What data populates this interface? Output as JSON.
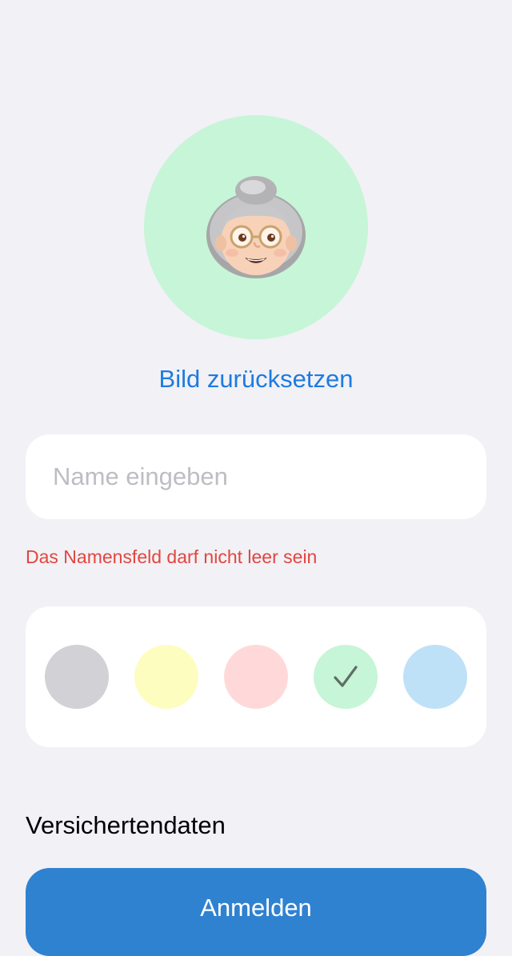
{
  "avatar": {
    "icon": "grandmother-memoji-icon",
    "background_color": "#C7F5D7"
  },
  "reset_link": {
    "label": "Bild zurücksetzen",
    "color": "#1E7BE0"
  },
  "name_field": {
    "value": "",
    "placeholder": "Name eingeben"
  },
  "validation": {
    "error": "Das Namensfeld darf nicht leer sein",
    "color": "#E1463F"
  },
  "color_picker": {
    "swatches": [
      {
        "name": "gray",
        "color": "#D1D1D6",
        "selected": false
      },
      {
        "name": "yellow",
        "color": "#FDFDC0",
        "selected": false
      },
      {
        "name": "pink",
        "color": "#FFD9D9",
        "selected": false
      },
      {
        "name": "green",
        "color": "#C7F5D7",
        "selected": true
      },
      {
        "name": "blue",
        "color": "#BFE1F8",
        "selected": false
      }
    ],
    "selected_icon": "checkmark-icon"
  },
  "section": {
    "title": "Versichertendaten"
  },
  "login_button": {
    "label": "Anmelden",
    "color": "#2F82D0"
  }
}
